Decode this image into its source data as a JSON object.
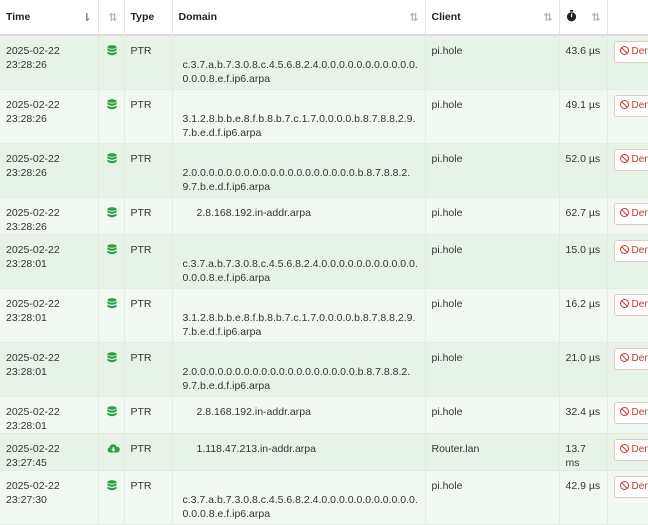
{
  "columns": {
    "time": "Time",
    "type": "Type",
    "domain": "Domain",
    "client": "Client"
  },
  "deny_label": "Deny",
  "rows": [
    {
      "time": "2025-02-22 23:28:26",
      "status_icon": "database-icon",
      "type": "PTR",
      "domain": "c.3.7.a.b.7.3.0.8.c.4.5.6.8.2.4.0.0.0.0.0.0.0.0.0.0.0.0.0.0.8.e.f.ip6.arpa",
      "client": "pi.hole",
      "reply_time": "43.6 µs"
    },
    {
      "time": "2025-02-22 23:28:26",
      "status_icon": "database-icon",
      "type": "PTR",
      "domain": "3.1.2.8.b.b.e.8.f.b.8.b.7.c.1.7.0.0.0.0.b.8.7.8.8.2.9.7.b.e.d.f.ip6.arpa",
      "client": "pi.hole",
      "reply_time": "49.1 µs"
    },
    {
      "time": "2025-02-22 23:28:26",
      "status_icon": "database-icon",
      "type": "PTR",
      "domain": "2.0.0.0.0.0.0.0.0.0.0.0.0.0.0.0.0.0.0.0.b.8.7.8.8.2.9.7.b.e.d.f.ip6.arpa",
      "client": "pi.hole",
      "reply_time": "52.0 µs"
    },
    {
      "time": "2025-02-22 23:28:26",
      "status_icon": "database-icon",
      "type": "PTR",
      "domain": "2.8.168.192.in-addr.arpa",
      "client": "pi.hole",
      "reply_time": "62.7 µs"
    },
    {
      "time": "2025-02-22 23:28:01",
      "status_icon": "database-icon",
      "type": "PTR",
      "domain": "c.3.7.a.b.7.3.0.8.c.4.5.6.8.2.4.0.0.0.0.0.0.0.0.0.0.0.0.0.0.8.e.f.ip6.arpa",
      "client": "pi.hole",
      "reply_time": "15.0 µs"
    },
    {
      "time": "2025-02-22 23:28:01",
      "status_icon": "database-icon",
      "type": "PTR",
      "domain": "3.1.2.8.b.b.e.8.f.b.8.b.7.c.1.7.0.0.0.0.b.8.7.8.8.2.9.7.b.e.d.f.ip6.arpa",
      "client": "pi.hole",
      "reply_time": "16.2 µs"
    },
    {
      "time": "2025-02-22 23:28:01",
      "status_icon": "database-icon",
      "type": "PTR",
      "domain": "2.0.0.0.0.0.0.0.0.0.0.0.0.0.0.0.0.0.0.0.b.8.7.8.8.2.9.7.b.e.d.f.ip6.arpa",
      "client": "pi.hole",
      "reply_time": "21.0 µs"
    },
    {
      "time": "2025-02-22 23:28:01",
      "status_icon": "database-icon",
      "type": "PTR",
      "domain": "2.8.168.192.in-addr.arpa",
      "client": "pi.hole",
      "reply_time": "32.4 µs"
    },
    {
      "time": "2025-02-22 23:27:45",
      "status_icon": "cloud-download-icon",
      "type": "PTR",
      "domain": "1.118.47.213.in-addr.arpa",
      "client": "Router.lan",
      "reply_time": "13.7 ms"
    },
    {
      "time": "2025-02-22 23:27:30",
      "status_icon": "database-icon",
      "type": "PTR",
      "domain": "c.3.7.a.b.7.3.0.8.c.4.5.6.8.2.4.0.0.0.0.0.0.0.0.0.0.0.0.0.0.8.e.f.ip6.arpa",
      "client": "pi.hole",
      "reply_time": "42.9 µs"
    }
  ],
  "colors": {
    "row_bg": "#e8f3e8",
    "row_alt_bg": "#f1f8f1",
    "status_icon": "#2e9e44",
    "deny": "#c0392b"
  }
}
